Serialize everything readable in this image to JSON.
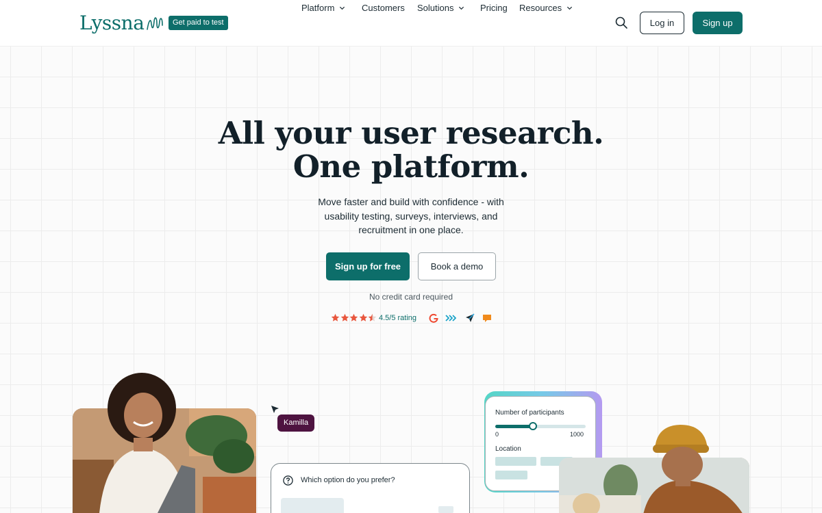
{
  "header": {
    "logo_text": "Lyssna",
    "promo_badge": "Get paid to test",
    "nav": [
      {
        "label": "Platform",
        "has_dropdown": true
      },
      {
        "label": "Customers",
        "has_dropdown": false
      },
      {
        "label": "Solutions",
        "has_dropdown": true
      },
      {
        "label": "Pricing",
        "has_dropdown": false
      },
      {
        "label": "Resources",
        "has_dropdown": true
      }
    ],
    "login_label": "Log in",
    "signup_label": "Sign up"
  },
  "hero": {
    "title_line1": "All your user research.",
    "title_line2": "One platform.",
    "subtitle": "Move faster and build with confidence - with usability testing, surveys, interviews, and recruitment in one place.",
    "cta_primary": "Sign up for free",
    "cta_secondary": "Book a demo",
    "no_cc_note": "No credit card required",
    "rating": {
      "stars_filled": 4.5,
      "stars_total": 5,
      "text": "4.5/5 rating",
      "review_sites": [
        "g2-icon",
        "capterra-icon",
        "getapp-icon",
        "trustradius-icon"
      ]
    }
  },
  "showcase": {
    "cursor_name": "Kamilla",
    "question_card": {
      "question": "Which option do you prefer?"
    },
    "participants_card": {
      "title": "Number of participants",
      "min_label": "0",
      "max_label": "1000",
      "slider_fraction": 0.42,
      "location_label": "Location"
    }
  },
  "colors": {
    "brand_teal": "#0d6e6a",
    "cursor_tag": "#4e1340",
    "star": "#e8573e",
    "text_dark": "#122029"
  }
}
